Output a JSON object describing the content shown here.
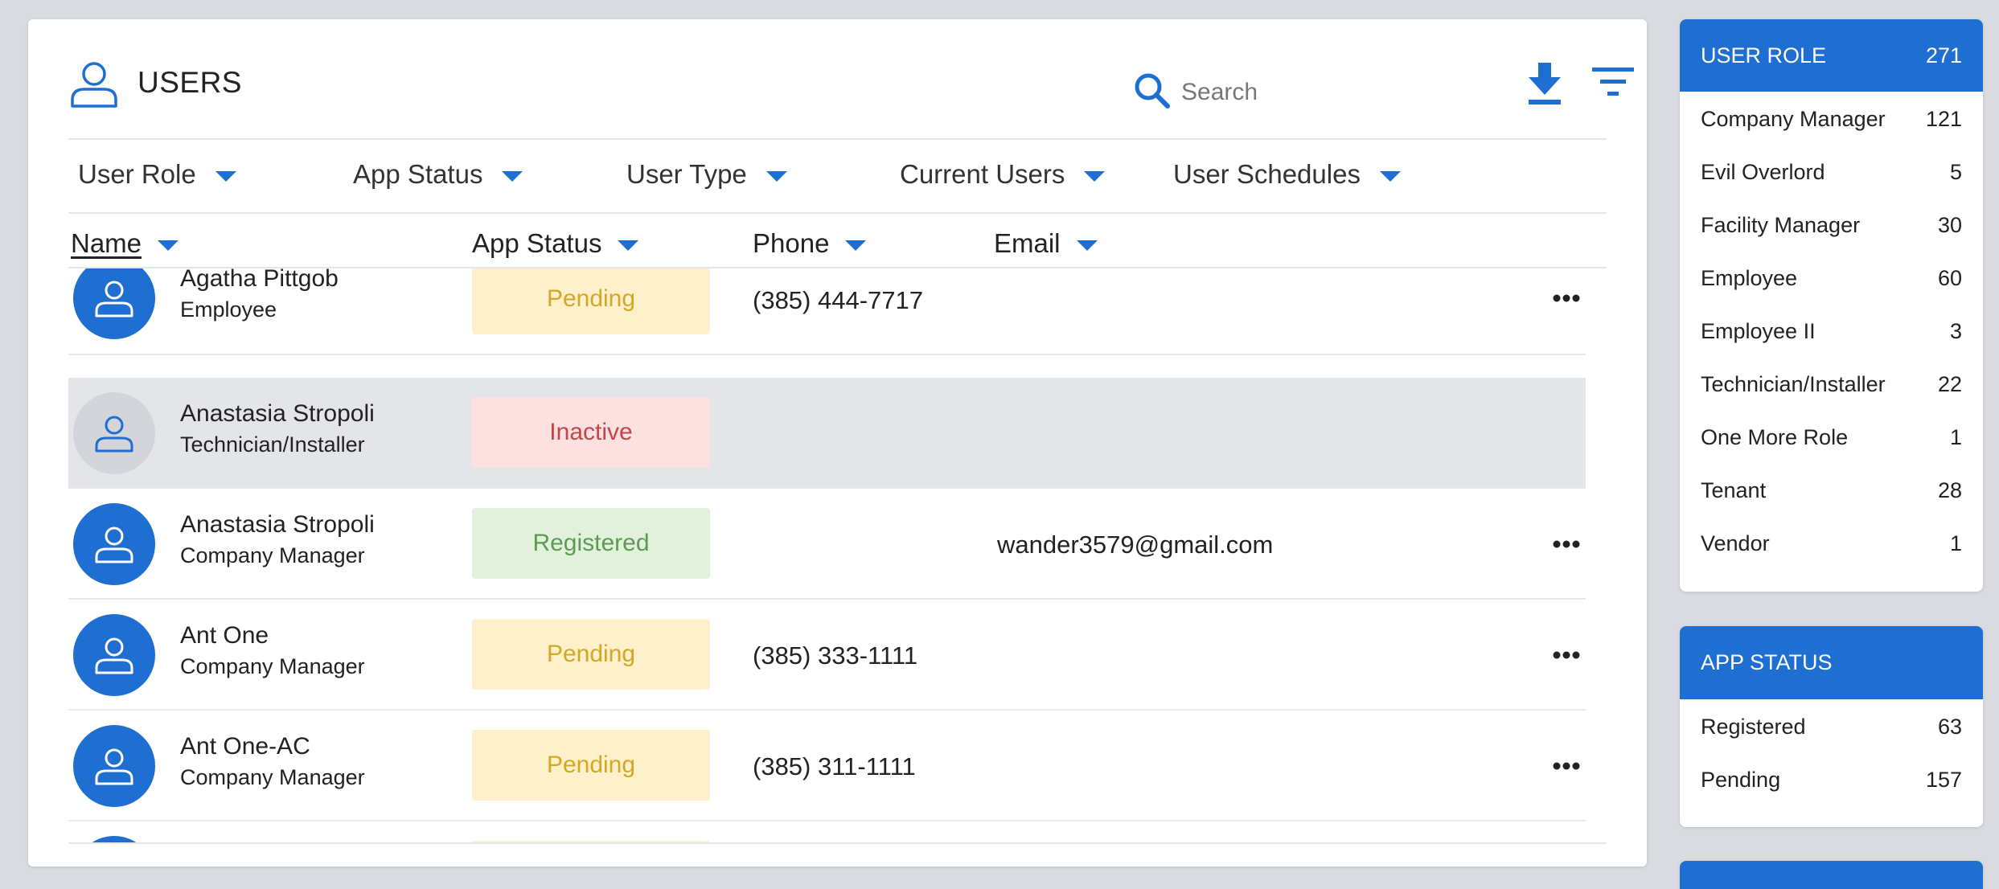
{
  "header": {
    "title": "USERS",
    "search_placeholder": "Search"
  },
  "filters": [
    "User Role",
    "App Status",
    "User Type",
    "Current Users",
    "User Schedules"
  ],
  "columns": [
    "Name",
    "App Status",
    "Phone",
    "Email"
  ],
  "rows": [
    {
      "name": "Agatha Pittgob",
      "role": "Employee",
      "status": "Pending",
      "phone": "(385) 444-7717",
      "email": ""
    },
    {
      "name": "Anastasia Stropoli",
      "role": "Technician/Installer",
      "status": "Inactive",
      "phone": "",
      "email": ""
    },
    {
      "name": "Anastasia Stropoli",
      "role": "Company Manager",
      "status": "Registered",
      "phone": "",
      "email": "wander3579@gmail.com"
    },
    {
      "name": "Ant One",
      "role": "Company Manager",
      "status": "Pending",
      "phone": "(385) 333-1111",
      "email": ""
    },
    {
      "name": "Ant One-AC",
      "role": "Company Manager",
      "status": "Pending",
      "phone": "(385) 311-1111",
      "email": ""
    }
  ],
  "user_role_panel": {
    "title": "USER ROLE",
    "total": "271",
    "items": [
      {
        "label": "Company Manager",
        "count": "121"
      },
      {
        "label": "Evil Overlord",
        "count": "5"
      },
      {
        "label": "Facility Manager",
        "count": "30"
      },
      {
        "label": "Employee",
        "count": "60"
      },
      {
        "label": "Employee II",
        "count": "3"
      },
      {
        "label": "Technician/Installer",
        "count": "22"
      },
      {
        "label": "One More Role",
        "count": "1"
      },
      {
        "label": "Tenant",
        "count": "28"
      },
      {
        "label": "Vendor",
        "count": "1"
      }
    ]
  },
  "app_status_panel": {
    "title": "APP STATUS",
    "items": [
      {
        "label": "Registered",
        "count": "63"
      },
      {
        "label": "Pending",
        "count": "157"
      }
    ]
  },
  "colors": {
    "accent": "#1e6fd1",
    "pending_bg": "#fdf0cb",
    "pending_text": "#d4a826",
    "inactive_bg": "#fde0e0",
    "inactive_text": "#c24848",
    "registered_bg": "#e1f1dc",
    "registered_text": "#5f9a55"
  }
}
